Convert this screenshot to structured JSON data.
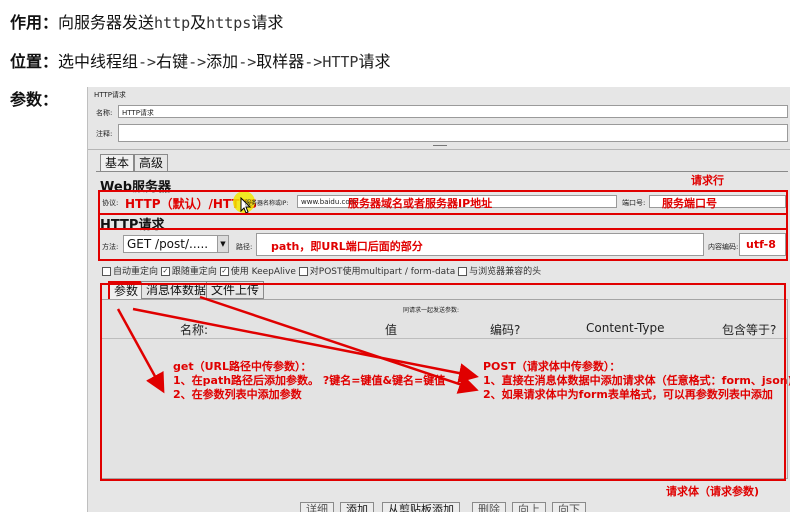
{
  "intro": {
    "line1_label": "作用：",
    "line1_text_a": "向服务器发送",
    "line1_mono_a": "http",
    "line1_text_b": "及",
    "line1_mono_b": "https",
    "line1_text_c": "请求",
    "line2_label": "位置：",
    "line2_text_a": "选中线程组",
    "line2_mono_a": "->",
    "line2_text_b": "右键",
    "line2_mono_b": "->",
    "line2_text_c": "添加",
    "line2_mono_c": "->",
    "line2_text_d": "取样器",
    "line2_mono_d": "->HTTP",
    "line2_text_e": "请求",
    "line3_label": "参数："
  },
  "sampler": {
    "panel_title": "HTTP请求",
    "name_label": "名称:",
    "name_value": "HTTP请求",
    "comment_label": "注释:",
    "tabs": [
      "基本",
      "高级"
    ],
    "web_server_header": "Web服务器",
    "protocol_label": "协议:",
    "protocol_value": "HTTP（默认）/HTTPS",
    "server_label": "服务器名称或IP:",
    "server_value": "www.baidu.com",
    "port_label": "端口号:",
    "http_request_header": "HTTP请求",
    "method_label": "方法:",
    "method_value": "GET /post/.....",
    "path_label": "路径:",
    "path_value": "path，即URL端口后面的部分",
    "encoding_label": "内容编码:",
    "encoding_value": "utf-8",
    "options": [
      {
        "label": "自动重定向",
        "checked": false
      },
      {
        "label": "跟随重定向",
        "checked": true
      },
      {
        "label": "使用 KeepAlive",
        "checked": true
      },
      {
        "label": "对POST使用multipart / form-data",
        "checked": false
      },
      {
        "label": "与浏览器兼容的头",
        "checked": false
      }
    ],
    "param_tabs": [
      "参数",
      "消息体数据",
      "文件上传"
    ],
    "table_caption": "同请求一起发送参数:",
    "columns": [
      "名称:",
      "值",
      "编码?",
      "Content-Type",
      "包含等于?"
    ],
    "buttons": [
      "详细",
      "添加",
      "从剪贴板添加",
      "删除",
      "向上",
      "向下"
    ]
  },
  "annotations": {
    "request_line": "请求行",
    "server_note": "服务器域名或者服务器IP地址",
    "port_note": "服务端口号",
    "get_title": "get（URL路径中传参数）：",
    "get_1": "1、在path路径后添加参数。 ?键名=键值&键名=键值",
    "get_2": "2、在参数列表中添加参数",
    "post_title": "POST（请求体中传参数）：",
    "post_1": "1、直接在消息体数据中添加请求体（任意格式：form、json)",
    "post_2": "2、如果请求体中为form表单格式，可以再参数列表中添加",
    "request_body": "请求体（请求参数)"
  },
  "colors": {
    "annotation_red": "#e00000",
    "cursor_highlight": "#f2e600"
  }
}
